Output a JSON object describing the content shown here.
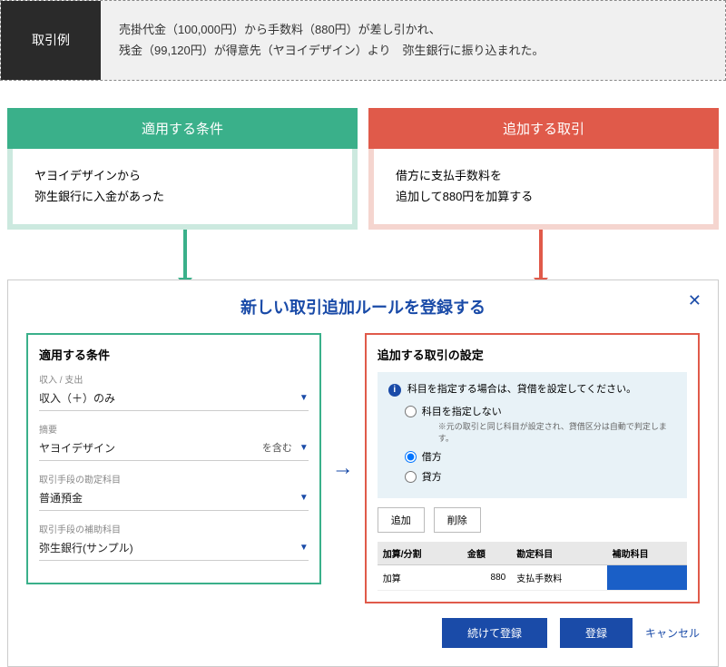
{
  "example": {
    "label": "取引例",
    "line1": "売掛代金（100,000円）から手数料（880円）が差し引かれ、",
    "line2": "残金（99,120円）が得意先（ヤヨイデザイン）より　弥生銀行に振り込まれた。"
  },
  "conditions": {
    "header": "適用する条件",
    "body_l1": "ヤヨイデザインから",
    "body_l2": "弥生銀行に入金があった"
  },
  "addition": {
    "header": "追加する取引",
    "body_l1": "借方に支払手数料を",
    "body_l2": "追加して880円を加算する"
  },
  "dialog": {
    "title": "新しい取引追加ルールを登録する",
    "close": "✕",
    "arrow": "→"
  },
  "cond_panel": {
    "title": "適用する条件",
    "f1_label": "収入 / 支出",
    "f1_value": "収入（＋）のみ",
    "f2_label": "摘要",
    "f2_value": "ヤヨイデザイン",
    "f2_suffix": "を含む",
    "f3_label": "取引手段の勘定科目",
    "f3_value": "普通預金",
    "f4_label": "取引手段の補助科目",
    "f4_value": "弥生銀行(サンプル)"
  },
  "add_panel": {
    "title": "追加する取引の設定",
    "info_title": "科目を指定する場合は、貸借を設定してください。",
    "r1": "科目を指定しない",
    "r1_sub": "※元の取引と同じ科目が設定され、貸借区分は自動で判定します。",
    "r2": "借方",
    "r3": "貸方",
    "btn_add": "追加",
    "btn_del": "削除",
    "th1": "加算/分割",
    "th2": "金額",
    "th3": "勘定科目",
    "th4": "補助科目",
    "td1": "加算",
    "td2": "880",
    "td3": "支払手数料"
  },
  "actions": {
    "continue": "続けて登録",
    "register": "登録",
    "cancel": "キャンセル"
  }
}
